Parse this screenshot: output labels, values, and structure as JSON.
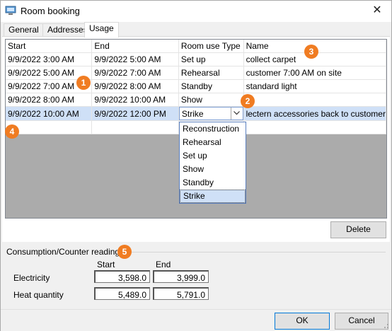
{
  "window": {
    "title": "Room booking",
    "close_label": "✕"
  },
  "tabs": [
    {
      "label": "General"
    },
    {
      "label": "Addresses"
    },
    {
      "label": "Usage"
    }
  ],
  "grid": {
    "columns": [
      "Start",
      "End",
      "Room use Type",
      "Name"
    ],
    "rows": [
      {
        "start": "9/9/2022 3:00 AM",
        "end": "9/9/2022 5:00 AM",
        "type": "Set up",
        "name": "collect carpet"
      },
      {
        "start": "9/9/2022 5:00 AM",
        "end": "9/9/2022 7:00 AM",
        "type": "Rehearsal",
        "name": "customer 7:00 AM on site"
      },
      {
        "start": "9/9/2022 7:00 AM",
        "end": "9/9/2022 8:00 AM",
        "type": "Standby",
        "name": "standard light"
      },
      {
        "start": "9/9/2022 8:00 AM",
        "end": "9/9/2022 10:00 AM",
        "type": "Show",
        "name": ""
      },
      {
        "start": "9/9/2022 10:00 AM",
        "end": "9/9/2022 12:00 PM",
        "type": "Strike",
        "name": "lectern accessories back to customer"
      }
    ],
    "dropdown_options": [
      "Reconstruction",
      "Rehearsal",
      "Set up",
      "Show",
      "Standby",
      "Strike"
    ],
    "dropdown_selected": "Strike"
  },
  "badges": [
    "1",
    "2",
    "3",
    "4",
    "5"
  ],
  "delete_label": "Delete",
  "consumption": {
    "group_label": "Consumption/Counter readings",
    "start_header": "Start",
    "end_header": "End",
    "items": [
      {
        "label": "Electricity",
        "start": "3,598.0",
        "end": "3,999.0"
      },
      {
        "label": "Heat quantity",
        "start": "5,489.0",
        "end": "5,791.0"
      }
    ]
  },
  "footer": {
    "ok_label": "OK",
    "cancel_label": "Cancel"
  },
  "colors": {
    "accent": "#f07c22",
    "selection": "#cfe0f7",
    "grid_bg": "#ababab"
  }
}
